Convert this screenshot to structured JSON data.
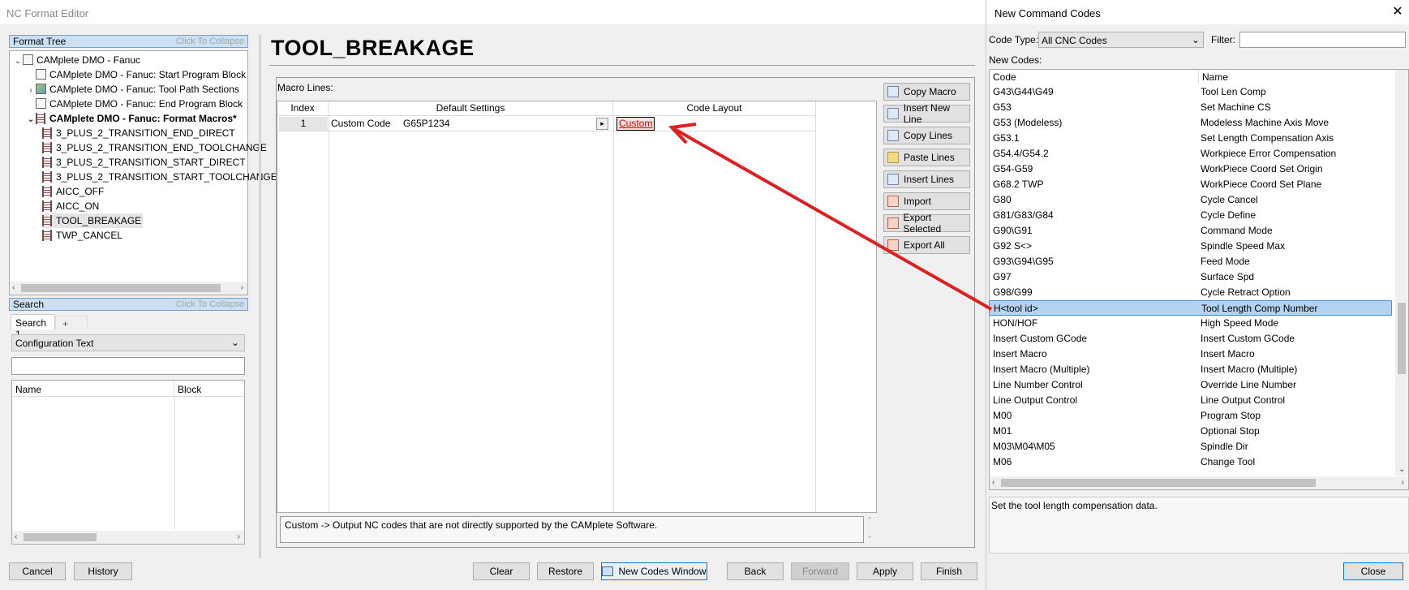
{
  "window": {
    "title": "NC Format Editor"
  },
  "format_tree": {
    "header": "Format Tree",
    "collapse_hint": "Click To Collapse",
    "root": "CAMplete DMO - Fanuc",
    "items": [
      "CAMplete DMO - Fanuc: Start Program Block",
      "CAMplete DMO - Fanuc: Tool Path Sections",
      "CAMplete DMO - Fanuc: End Program Block",
      "CAMplete DMO - Fanuc: Format Macros*"
    ],
    "macros": [
      "3_PLUS_2_TRANSITION_END_DIRECT",
      "3_PLUS_2_TRANSITION_END_TOOLCHANGE",
      "3_PLUS_2_TRANSITION_START_DIRECT",
      "3_PLUS_2_TRANSITION_START_TOOLCHANGE",
      "AICC_OFF",
      "AICC_ON",
      "TOOL_BREAKAGE",
      "TWP_CANCEL"
    ]
  },
  "search": {
    "header": "Search",
    "collapse_hint": "Click To Collapse",
    "tab": "Search 1",
    "add_tab": "+",
    "mode": "Configuration Text",
    "query": "",
    "col_name": "Name",
    "col_block": "Block"
  },
  "editor": {
    "title": "TOOL_BREAKAGE",
    "macro_lines_label": "Macro Lines:",
    "col_index": "Index",
    "col_default": "Default Settings",
    "col_layout": "Code Layout",
    "row": {
      "index": "1",
      "type": "Custom Code",
      "value": "G65P1234",
      "layout": "Custom"
    },
    "description": "Custom -> Output NC codes that are not directly supported by the CAMplete Software."
  },
  "side_buttons": [
    "Copy Macro",
    "Insert New Line",
    "Copy Lines",
    "Paste Lines",
    "Insert Lines",
    "Import",
    "Export Selected",
    "Export All"
  ],
  "bottom_buttons": {
    "cancel": "Cancel",
    "history": "History",
    "clear": "Clear",
    "restore": "Restore",
    "new_codes": "New Codes Window",
    "back": "Back",
    "forward": "Forward",
    "apply": "Apply",
    "finish": "Finish"
  },
  "new_codes": {
    "title": "New Command Codes",
    "code_type_label": "Code Type:",
    "code_type": "All CNC Codes",
    "filter_label": "Filter:",
    "filter_value": "",
    "list_label": "New Codes:",
    "col_code": "Code",
    "col_name": "Name",
    "rows": [
      [
        "G43\\G44\\G49",
        "Tool Len Comp"
      ],
      [
        "G53",
        "Set Machine CS"
      ],
      [
        "G53 (Modeless)",
        "Modeless Machine Axis Move"
      ],
      [
        "G53.1",
        "Set Length Compensation Axis"
      ],
      [
        "G54.4/G54.2",
        "Workpiece Error Compensation"
      ],
      [
        "G54-G59",
        "WorkPiece Coord Set Origin"
      ],
      [
        "G68.2 TWP",
        "WorkPiece Coord Set Plane"
      ],
      [
        "G80",
        "Cycle Cancel"
      ],
      [
        "G81/G83/G84",
        "Cycle Define"
      ],
      [
        "G90\\G91",
        "Command Mode"
      ],
      [
        "G92 S<>",
        "Spindle Speed Max"
      ],
      [
        "G93\\G94\\G95",
        "Feed Mode"
      ],
      [
        "G97",
        "Surface Spd"
      ],
      [
        "G98/G99",
        "Cycle Retract Option"
      ],
      [
        "H<tool id>",
        "Tool Length Comp Number"
      ],
      [
        "HON/HOF",
        "High Speed Mode"
      ],
      [
        "Insert Custom GCode",
        "Insert Custom GCode"
      ],
      [
        "Insert Macro",
        "Insert Macro"
      ],
      [
        "Insert Macro (Multiple)",
        "Insert Macro (Multiple)"
      ],
      [
        "Line Number Control",
        "Override Line Number"
      ],
      [
        "Line Output Control",
        "Line Output Control"
      ],
      [
        "M00",
        "Program Stop"
      ],
      [
        "M01",
        "Optional Stop"
      ],
      [
        "M03\\M04\\M05",
        "Spindle Dir"
      ],
      [
        "M06",
        "Change Tool"
      ]
    ],
    "selected_index": 14,
    "description": "Set the tool length compensation data.",
    "close": "Close"
  }
}
